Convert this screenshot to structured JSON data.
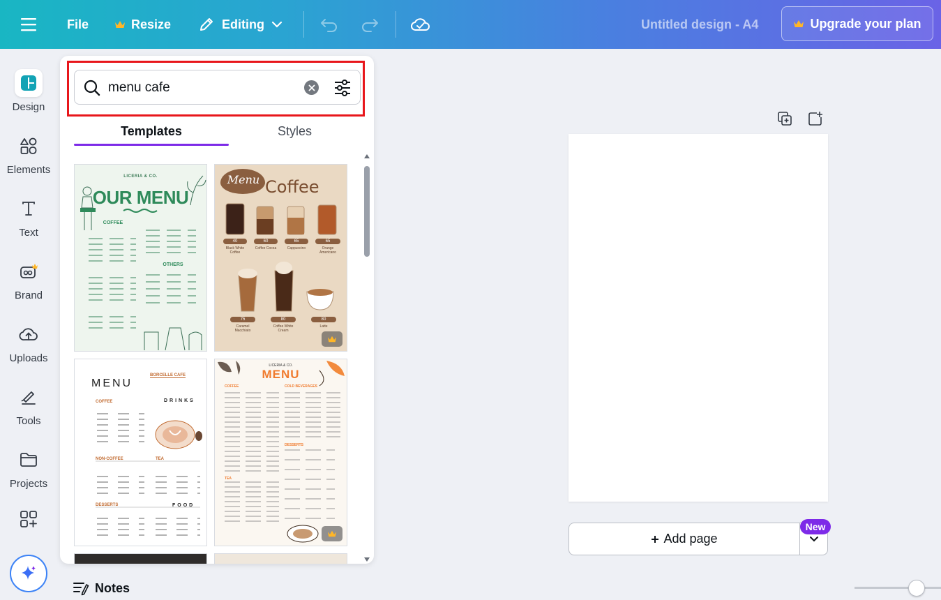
{
  "topbar": {
    "file": "File",
    "resize": "Resize",
    "mode": "Editing",
    "doc_title": "Untitled design - A4",
    "upgrade": "Upgrade your plan"
  },
  "rail": {
    "items": [
      {
        "label": "Design",
        "icon": "design-icon"
      },
      {
        "label": "Elements",
        "icon": "elements-icon"
      },
      {
        "label": "Text",
        "icon": "text-icon"
      },
      {
        "label": "Brand",
        "icon": "brand-icon"
      },
      {
        "label": "Uploads",
        "icon": "uploads-icon"
      },
      {
        "label": "Tools",
        "icon": "tools-icon"
      },
      {
        "label": "Projects",
        "icon": "projects-icon"
      },
      {
        "label": "",
        "icon": "apps-icon"
      }
    ]
  },
  "search": {
    "value": "menu cafe"
  },
  "tabs": [
    "Templates",
    "Styles"
  ],
  "templates": {
    "t1": {
      "brand": "LICERIA & CO.",
      "title": "OUR MENU",
      "col1_head": "COFFEE",
      "col2_head": "OTHERS"
    },
    "t2": {
      "script": "Menu",
      "title": "Coffee",
      "row1": [
        {
          "price": "40",
          "name": "Black White Coffee"
        },
        {
          "price": "60",
          "name": "Coffee Cocoa"
        },
        {
          "price": "65",
          "name": "Cappuccino"
        },
        {
          "price": "65",
          "name": "Orange Americano"
        }
      ],
      "row2": [
        {
          "price": "75",
          "name": "Caramel Macchiato"
        },
        {
          "price": "80",
          "name": "Coffee White Cream"
        },
        {
          "price": "80",
          "name": "Latte"
        }
      ]
    },
    "t3": {
      "title": "MENU",
      "brand": "BORCELLE CAFE",
      "drinks": "DRINKS",
      "coffee": "COFFEE",
      "noncoffee": "NON-COFFEE",
      "tea": "TEA",
      "desserts": "DESSERTS",
      "food": "FOOD"
    },
    "t4": {
      "brand": "LICERIA & CO.",
      "title": "MENU",
      "coffee": "COFFEE",
      "cold": "COLD BEVERAGES",
      "desserts": "DESSERTS",
      "tea": "TEA"
    }
  },
  "canvas": {
    "add_page": "Add page",
    "new_badge": "New"
  },
  "footer": {
    "notes": "Notes"
  },
  "colors": {
    "accent": "#7d2ae8",
    "highlight": "#e8161b"
  }
}
